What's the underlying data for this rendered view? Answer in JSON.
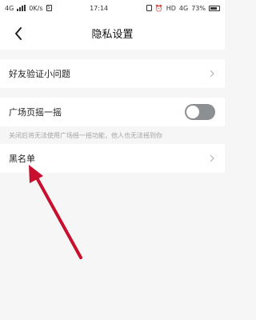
{
  "status_bar": {
    "network": "4G",
    "speed": "0K/s",
    "notification_count": "5",
    "time": "17:14",
    "hd": "HD",
    "network_right": "4G",
    "battery": "73%"
  },
  "nav": {
    "title": "隐私设置",
    "back_icon": "chevron-left-icon"
  },
  "settings": {
    "friend_question_label": "好友验证小问题",
    "square_shake_label": "广场页摇一摇",
    "square_shake_enabled": false,
    "square_shake_hint": "关闭后将无法使用广场摇一摇功能，他人也无法摇到你",
    "blacklist_label": "黑名单"
  },
  "annotation": {
    "arrow_color": "#c8102e"
  }
}
